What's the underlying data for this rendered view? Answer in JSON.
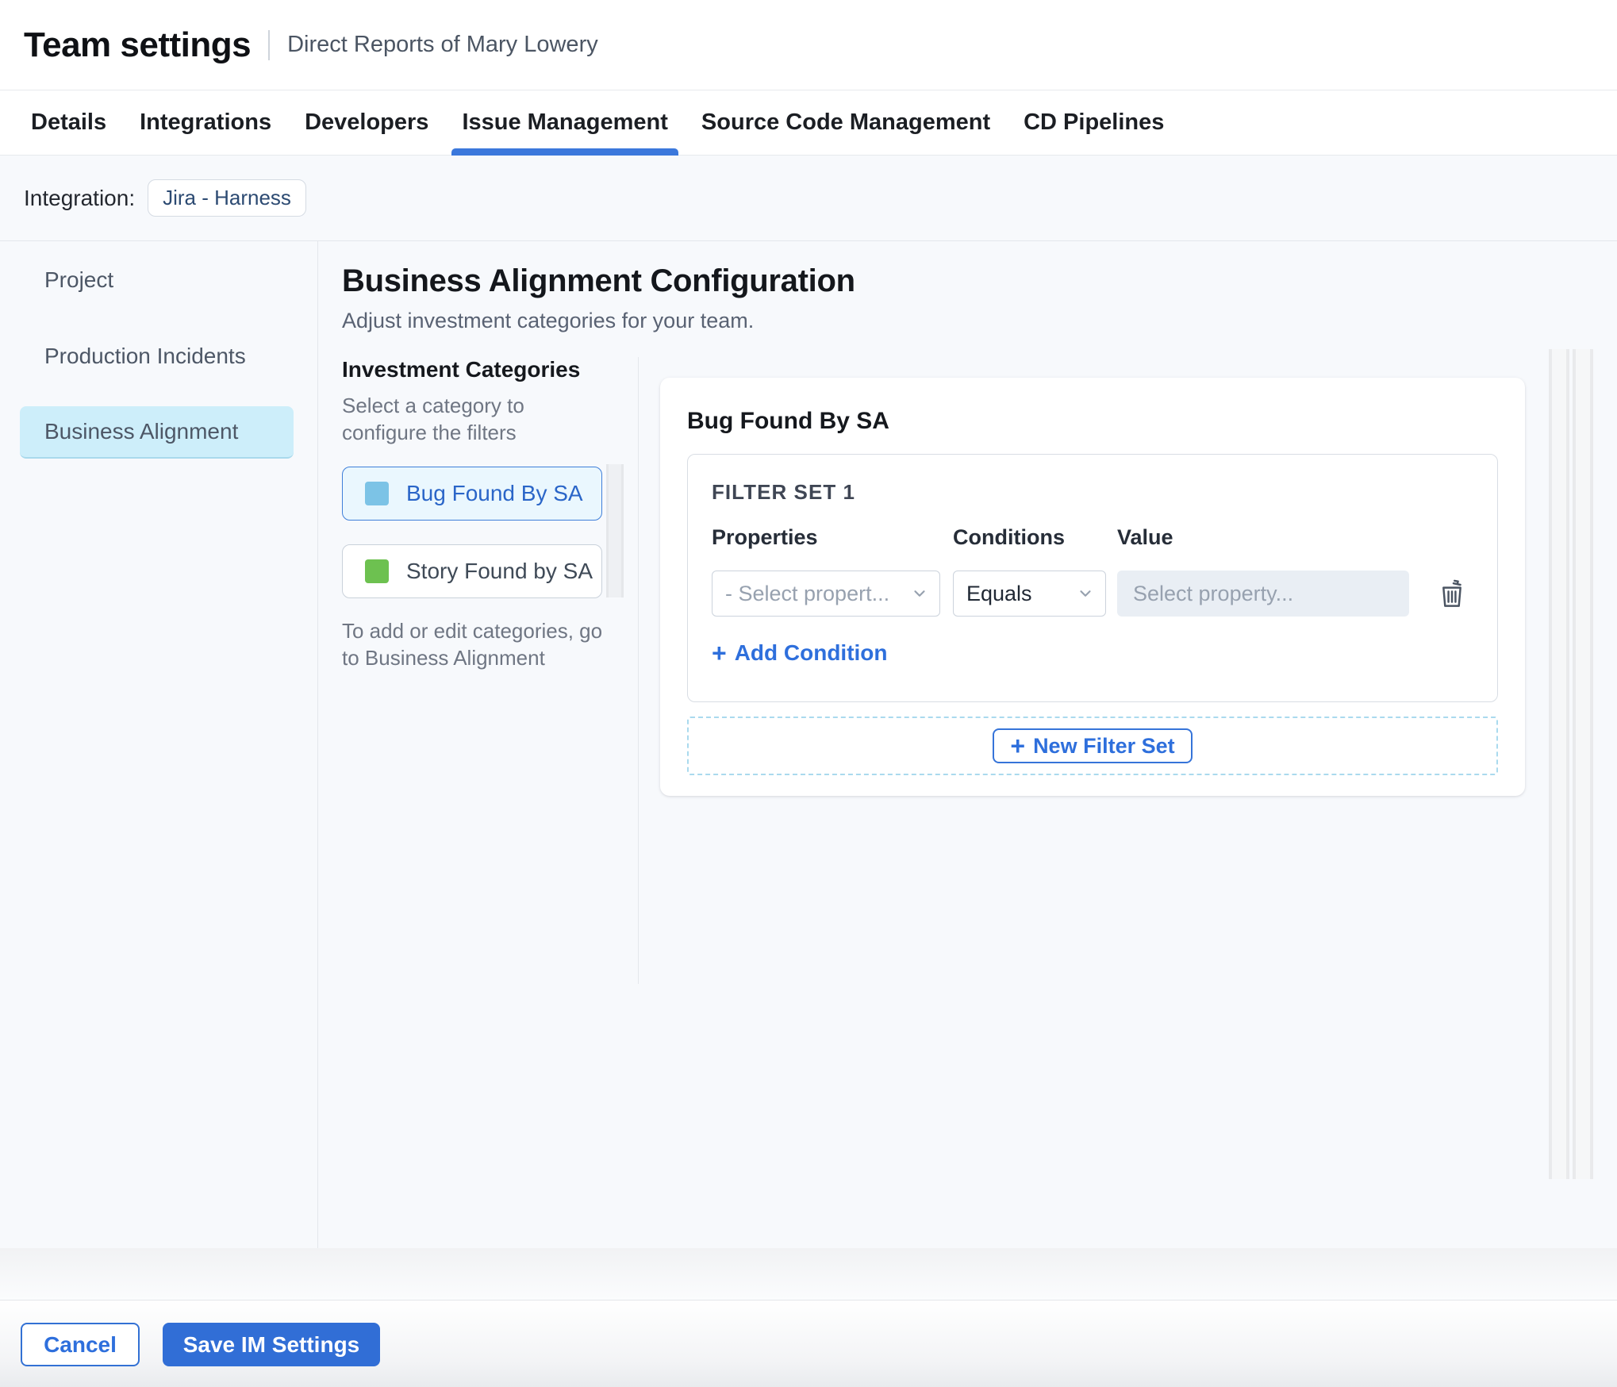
{
  "header": {
    "title": "Team settings",
    "subtitle": "Direct Reports of Mary Lowery"
  },
  "tabs": [
    {
      "label": "Details"
    },
    {
      "label": "Integrations"
    },
    {
      "label": "Developers"
    },
    {
      "label": "Issue Management",
      "active": true
    },
    {
      "label": "Source Code Management"
    },
    {
      "label": "CD Pipelines"
    }
  ],
  "integration": {
    "label": "Integration:",
    "chip": "Jira - Harness"
  },
  "sidebar": {
    "items": [
      {
        "label": "Project"
      },
      {
        "label": "Production Incidents"
      },
      {
        "label": "Business Alignment",
        "selected": true
      }
    ]
  },
  "main": {
    "title": "Business Alignment Configuration",
    "subtitle": "Adjust investment categories for your team.",
    "categories": {
      "heading": "Investment Categories",
      "hint": "Select a category to configure the filters",
      "items": [
        {
          "label": "Bug Found By SA",
          "swatch_color": "#7cc3e6",
          "selected": true
        },
        {
          "label": "Story Found by SA",
          "swatch_color": "#6dc150",
          "selected": false
        }
      ],
      "footnote": "To add or edit categories, go to Business Alignment"
    },
    "panel": {
      "title": "Bug Found By SA",
      "filter_set": {
        "label": "FILTER SET 1",
        "columns": [
          "Properties",
          "Conditions",
          "Value"
        ],
        "property_placeholder": "- Select propert...",
        "condition_value": "Equals",
        "value_placeholder": "Select property...",
        "add_condition_label": "Add Condition"
      },
      "new_filter_set_label": "New Filter Set"
    }
  },
  "footer": {
    "cancel_label": "Cancel",
    "save_label": "Save IM Settings"
  },
  "colors": {
    "accent_blue": "#3674d9",
    "link_blue": "#2e6fdc",
    "tab_underline": "#3b78dc",
    "sidebar_selected_bg": "#cdeefa",
    "bug_swatch": "#7cc3e6",
    "story_swatch": "#6dc150",
    "save_button_bg": "#316ed6"
  }
}
